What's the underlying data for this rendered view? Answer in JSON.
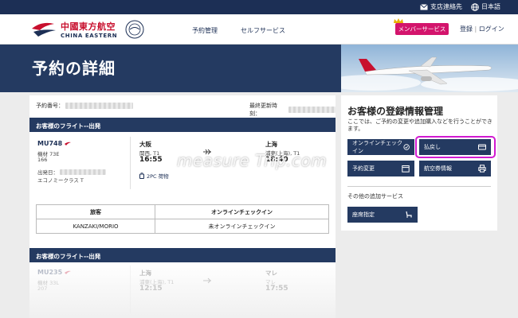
{
  "topbar": {
    "branch_contact": "支店連絡先",
    "language": "日本語"
  },
  "header": {
    "logo_cn": "中國東方航空",
    "logo_en": "CHINA EASTERN",
    "nav": [
      "予約管理",
      "セルフサービス"
    ],
    "member_button": "メンバーサービス",
    "register": "登録",
    "separator": "|",
    "login": "ログイン"
  },
  "page": {
    "title": "予約の詳細"
  },
  "booking": {
    "number_label": "予約番号：",
    "updated_label": "最終更新時刻："
  },
  "outbound": {
    "header": "お客様のフライト--出発",
    "flight_no": "MU748",
    "aircraft": "機材 73E",
    "seq": "166",
    "date_label": "出発日：",
    "cabin": "エコノミークラス T",
    "origin_city": "大阪",
    "origin_airport": "関西, T1",
    "dep_time": "16:55",
    "dest_city": "上海",
    "dest_airport": "浦東(上海), T1",
    "arr_time": "18:40",
    "baggage": "2PC 荷物"
  },
  "passengers": {
    "col_passenger": "旅客",
    "col_checkin": "オンラインチェックイン",
    "rows": [
      {
        "name": "KANZAKI/MORIO",
        "status": "未オンラインチェックイン"
      }
    ]
  },
  "outbound2": {
    "header": "お客様のフライト--出発",
    "flight_no": "MU235",
    "aircraft": "機材 33L",
    "seq": "207",
    "origin_city": "上海",
    "origin_airport": "浦東(上海), T1",
    "dep_time": "12:15",
    "dest_city": "マレ",
    "dest_airport": "マレ",
    "arr_time": "17:55"
  },
  "side": {
    "title": "お客様の登録情報管理",
    "desc": "ここでは、ご予約の変更や追加購入などを行うことができます。",
    "buttons": {
      "online_checkin": "オンラインチェックイン",
      "refund": "払戻し",
      "change": "予約変更",
      "ticket_info": "航空券情報",
      "seat": "座席指定"
    },
    "other_label": "その他の追加サービス"
  },
  "watermark": "measure Trip.com",
  "colors": {
    "navy": "#243a61",
    "member": "#d3146c",
    "highlight": "#d11ad1",
    "brand_red": "#c8102e"
  }
}
